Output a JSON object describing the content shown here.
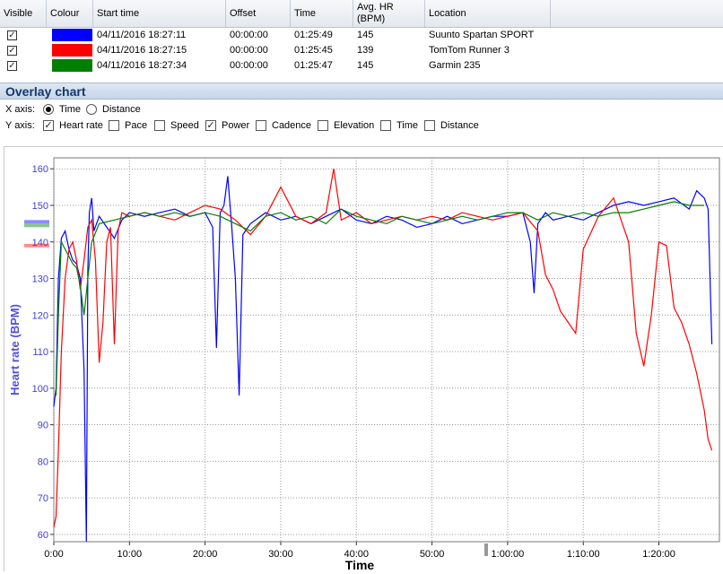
{
  "table": {
    "headers": {
      "visible": "Visible",
      "colour": "Colour",
      "start_time": "Start time",
      "offset": "Offset",
      "time": "Time",
      "avg_hr": "Avg. HR (BPM)",
      "location": "Location"
    },
    "rows": [
      {
        "visible": true,
        "colour": "#0000ff",
        "start_time": "04/11/2016 18:27:11",
        "offset": "00:00:00",
        "time": "01:25:49",
        "avg_hr": "145",
        "location": "Suunto Spartan SPORT"
      },
      {
        "visible": true,
        "colour": "#ff0000",
        "start_time": "04/11/2016 18:27:15",
        "offset": "00:00:00",
        "time": "01:25:45",
        "avg_hr": "139",
        "location": "TomTom Runner 3"
      },
      {
        "visible": true,
        "colour": "#008000",
        "start_time": "04/11/2016 18:27:34",
        "offset": "00:00:00",
        "time": "01:25:47",
        "avg_hr": "145",
        "location": "Garmin 235"
      }
    ]
  },
  "overlay": {
    "title": "Overlay chart",
    "x_axis_label": "X axis:",
    "x_options": [
      {
        "label": "Time",
        "selected": true
      },
      {
        "label": "Distance",
        "selected": false
      }
    ],
    "y_axis_label": "Y axis:",
    "y_options": [
      {
        "label": "Heart rate",
        "checked": true
      },
      {
        "label": "Pace",
        "checked": false
      },
      {
        "label": "Speed",
        "checked": false
      },
      {
        "label": "Power",
        "checked": true
      },
      {
        "label": "Cadence",
        "checked": false
      },
      {
        "label": "Elevation",
        "checked": false
      },
      {
        "label": "Time",
        "checked": false
      },
      {
        "label": "Distance",
        "checked": false
      }
    ]
  },
  "chart_data": {
    "type": "line",
    "xlabel": "Time",
    "ylabel": "Heart rate (BPM)",
    "xlim": [
      0,
      88
    ],
    "ylim": [
      58,
      163
    ],
    "x_ticks": [
      "0:00",
      "10:00",
      "20:00",
      "30:00",
      "40:00",
      "50:00",
      "1:00:00",
      "1:10:00",
      "1:20:00"
    ],
    "y_ticks": [
      60,
      70,
      80,
      90,
      100,
      110,
      120,
      130,
      140,
      150,
      160
    ],
    "grid": true,
    "series": [
      {
        "color": "#0000ff",
        "x": [
          0,
          0.3,
          0.6,
          1,
          1.5,
          2,
          2.5,
          3,
          3.5,
          4,
          4.3,
          4.5,
          4.7,
          5,
          5.3,
          6,
          7,
          8,
          9,
          10,
          12,
          14,
          16,
          18,
          20,
          21,
          21.5,
          22,
          22.5,
          23,
          23.5,
          24,
          24.5,
          25,
          26,
          28,
          30,
          32,
          34,
          36,
          38,
          40,
          42,
          44,
          46,
          48,
          50,
          52,
          54,
          56,
          58,
          60,
          62,
          63,
          63.5,
          64,
          65,
          66,
          68,
          70,
          72,
          74,
          76,
          78,
          80,
          82,
          84,
          85,
          86,
          86.5,
          87
        ],
        "y": [
          95,
          100,
          130,
          141,
          143,
          138,
          135,
          134,
          130,
          105,
          58,
          132,
          148,
          152,
          143,
          147,
          144,
          141,
          146,
          148,
          147,
          148,
          149,
          147,
          148,
          144,
          111,
          148,
          150,
          158,
          145,
          130,
          98,
          142,
          145,
          148,
          146,
          147,
          145,
          147,
          149,
          146,
          145,
          147,
          146,
          144,
          145,
          147,
          145,
          146,
          147,
          147,
          148,
          140,
          126,
          145,
          148,
          146,
          147,
          146,
          148,
          150,
          151,
          150,
          151,
          152,
          149,
          154,
          152,
          149,
          112
        ]
      },
      {
        "color": "#ff0000",
        "x": [
          0,
          0.3,
          0.6,
          1,
          1.5,
          2,
          2.5,
          3,
          3.5,
          4,
          4.5,
          5,
          5.5,
          6,
          6.5,
          7,
          7.5,
          8,
          8.5,
          9,
          10,
          12,
          14,
          16,
          18,
          20,
          22,
          24,
          26,
          28,
          30,
          32,
          34,
          36,
          37,
          38,
          40,
          42,
          44,
          46,
          48,
          50,
          52,
          54,
          56,
          58,
          60,
          62,
          64,
          65,
          66,
          67,
          68,
          69,
          70,
          72,
          74,
          76,
          77,
          78,
          79,
          80,
          81,
          82,
          83,
          84,
          85,
          86,
          86.5,
          87
        ],
        "y": [
          62,
          65,
          83,
          110,
          130,
          138,
          140,
          135,
          127,
          135,
          144,
          146,
          135,
          107,
          118,
          140,
          144,
          112,
          143,
          148,
          147,
          148,
          147,
          146,
          148,
          150,
          149,
          146,
          142,
          147,
          155,
          147,
          145,
          148,
          160,
          146,
          148,
          145,
          146,
          147,
          146,
          147,
          146,
          148,
          147,
          146,
          147,
          148,
          143,
          131,
          127,
          121,
          118,
          115,
          138,
          147,
          152,
          140,
          115,
          106,
          120,
          140,
          139,
          122,
          118,
          112,
          104,
          94,
          86,
          83
        ]
      },
      {
        "color": "#008000",
        "x": [
          0.3,
          0.6,
          1,
          1.5,
          2,
          2.5,
          3,
          3.5,
          4,
          5,
          6,
          8,
          10,
          12,
          14,
          16,
          18,
          20,
          22,
          24,
          26,
          28,
          30,
          32,
          34,
          36,
          38,
          40,
          42,
          44,
          46,
          48,
          50,
          52,
          54,
          56,
          58,
          60,
          62,
          64,
          66,
          68,
          70,
          72,
          74,
          76,
          78,
          80,
          82,
          84,
          86
        ],
        "y": [
          98,
          120,
          140,
          138,
          136,
          134,
          133,
          128,
          120,
          140,
          145,
          146,
          147,
          148,
          147,
          148,
          147,
          148,
          147,
          145,
          143,
          147,
          148,
          146,
          147,
          145,
          149,
          147,
          146,
          145,
          147,
          146,
          145,
          146,
          147,
          146,
          147,
          148,
          148,
          146,
          148,
          147,
          148,
          147,
          148,
          148,
          149,
          150,
          151,
          150,
          150
        ]
      }
    ]
  }
}
